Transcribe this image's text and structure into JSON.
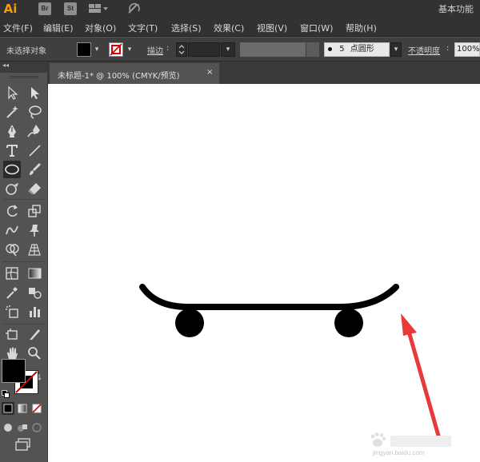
{
  "app": {
    "logo": "Ai",
    "bridge_badge": "Br",
    "stock_badge": "St",
    "workspace": "基本功能",
    "accent_color": "#ff9a00"
  },
  "menu": [
    {
      "label": "文件(F)"
    },
    {
      "label": "编辑(E)"
    },
    {
      "label": "对象(O)"
    },
    {
      "label": "文字(T)"
    },
    {
      "label": "选择(S)"
    },
    {
      "label": "效果(C)"
    },
    {
      "label": "视图(V)"
    },
    {
      "label": "窗口(W)"
    },
    {
      "label": "帮助(H)"
    }
  ],
  "control_bar": {
    "selection_status": "未选择对象",
    "stroke_label": "描边",
    "stroke_separator": ":",
    "brush_size": "5",
    "brush_shape": "点圆形",
    "opacity_label": "不透明度",
    "opacity_separator": ":",
    "opacity_value": "100%",
    "fill_color": "#000000",
    "stroke_color": "none"
  },
  "toolbar": {
    "collapse_glyph": "◂◂",
    "fill_color": "#000000",
    "stroke_color": "none"
  },
  "document": {
    "tab_title": "未标题-1* @ 100% (CMYK/预览)",
    "close_glyph": "×"
  },
  "canvas": {
    "artwork": "skateboard",
    "annotation": "red-arrow"
  },
  "watermark": {
    "text": "jingyan.baidu.com"
  }
}
